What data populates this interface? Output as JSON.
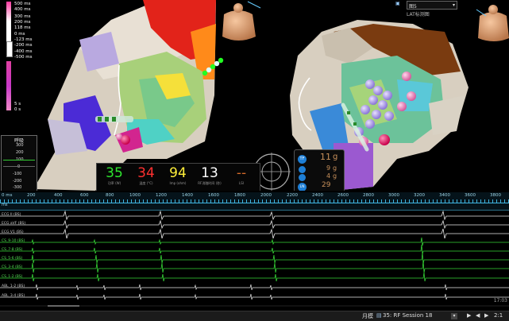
{
  "colors": {
    "metric_impedance_green": "#2fe62f",
    "metric_temp_red": "#ff3030",
    "metric_imp_yellow": "#ffef3a",
    "metric_time_white": "#ffffff",
    "metric_lsi_orange": "#d46b2a",
    "ecg_green": "#36d636",
    "timeline_blue": "#40b4e0"
  },
  "top_right_panel": {
    "map_select": "图5",
    "map_label": "LAT标测图"
  },
  "lat_scale": {
    "labels": [
      "500 ms",
      "400 ms",
      "300 ms",
      "200 ms",
      "118 ms",
      "0 ms",
      "-123 ms",
      "-200 ms",
      "-400 ms",
      "-500 ms",
      "5 s",
      "0 s"
    ]
  },
  "respiration_panel": {
    "title": "呼吸",
    "ticks": [
      "300",
      "200",
      "100",
      "0",
      "-100",
      "-200",
      "-300"
    ]
  },
  "ablation_metrics": [
    {
      "value": "35",
      "label": "功率 (W)"
    },
    {
      "value": "34",
      "label": "温度 (°C)"
    },
    {
      "value": "94",
      "label": "Imp (ohm)"
    },
    {
      "value": "13",
      "label": "RF消融时间 (秒)"
    },
    {
      "value": "--",
      "label": "LSI"
    }
  ],
  "force_panel": {
    "badges": [
      "TF",
      "LN"
    ],
    "values": [
      "11",
      "9",
      "4",
      "29"
    ],
    "units": [
      "g",
      "g",
      "g",
      ""
    ]
  },
  "timeline": {
    "ticks": [
      "0 ms",
      "200",
      "400",
      "600",
      "800",
      "1000",
      "1200",
      "1400",
      "1600",
      "1800",
      "2000",
      "2200",
      "2400",
      "2600",
      "2800",
      "3000",
      "3200",
      "3400",
      "3600",
      "3800"
    ],
    "ms_label": "ms"
  },
  "ecg_channels": [
    {
      "label": "ECG II (BS)"
    },
    {
      "label": "ECG aVF (BS)"
    },
    {
      "label": "ECG V1 (BS)"
    },
    {
      "label": "CS_9-10 (BS)"
    },
    {
      "label": "CS_7-8 (BS)"
    },
    {
      "label": "CS_5-6 (BS)"
    },
    {
      "label": "CS_3-4 (BS)"
    },
    {
      "label": "CS_1-2 (BS)"
    },
    {
      "label": "ABL_1-2 (BS)"
    },
    {
      "label": "ABL_3-4 (BS)"
    }
  ],
  "status_bar": {
    "time": "17:03",
    "mode_label": "月模",
    "session": "35: RF Session 18",
    "speed": "2:1"
  }
}
